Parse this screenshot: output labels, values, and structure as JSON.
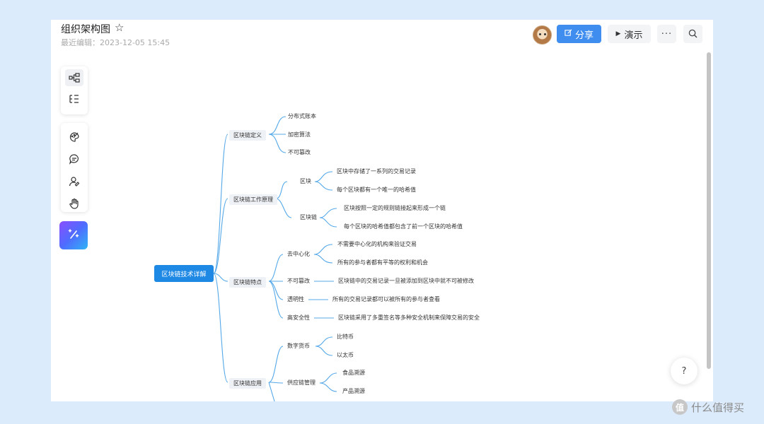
{
  "header": {
    "title": "组织架构图",
    "star_icon": "star-icon",
    "edit_time": "最近编辑：2023-12-05 15:45",
    "share_label": "分享",
    "share_icon": "edit-icon",
    "present_label": "演示",
    "present_icon": "play-icon",
    "more_label": "···",
    "search_icon": "search-icon"
  },
  "toolbar": {
    "group1": [
      "mindmap-icon",
      "outline-icon"
    ],
    "group2": [
      "palette-icon",
      "comment-icon",
      "user-edit-icon",
      "hand-icon"
    ],
    "ai_icon": "magic-wand-icon"
  },
  "mindmap": {
    "root": "区块链技术详解",
    "branches": [
      {
        "label": "区块链定义",
        "children": [
          "分布式账本",
          "加密算法",
          "不可篡改"
        ]
      },
      {
        "label": "区块链工作原理",
        "children": [
          {
            "label": "区块",
            "children": [
              "区块中存储了一系列的交易记录",
              "每个区块都有一个唯一的哈希值"
            ]
          },
          {
            "label": "区块链",
            "children": [
              "区块按照一定的规则链接起来形成一个链",
              "每个区块的哈希值都包含了前一个区块的哈希值"
            ]
          }
        ]
      },
      {
        "label": "区块链特点",
        "children": [
          {
            "label": "去中心化",
            "children": [
              "不需要中心化的机构来验证交易",
              "所有的参与者都有平等的权利和机会"
            ]
          },
          {
            "label": "不可篡改",
            "children": [
              "区块链中的交易记录一旦被添加到区块中就不可被修改"
            ]
          },
          {
            "label": "透明性",
            "children": [
              "所有的交易记录都可以被所有的参与者查看"
            ]
          },
          {
            "label": "高安全性",
            "children": [
              "区块链采用了多重签名等多种安全机制来保障交易的安全"
            ]
          }
        ]
      },
      {
        "label": "区块链应用",
        "children": [
          {
            "label": "数字货币",
            "children": [
              "比特币",
              "以太币"
            ]
          },
          {
            "label": "供应链管理",
            "children": [
              "食品溯源",
              "产品溯源"
            ]
          }
        ]
      }
    ]
  },
  "help_label": "?",
  "watermark": {
    "logo_text": "值",
    "text": "什么值得买"
  },
  "colors": {
    "accent": "#3f8dee",
    "root": "#1e88e5",
    "line": "#54a8e8",
    "background": "#dcebfb"
  }
}
